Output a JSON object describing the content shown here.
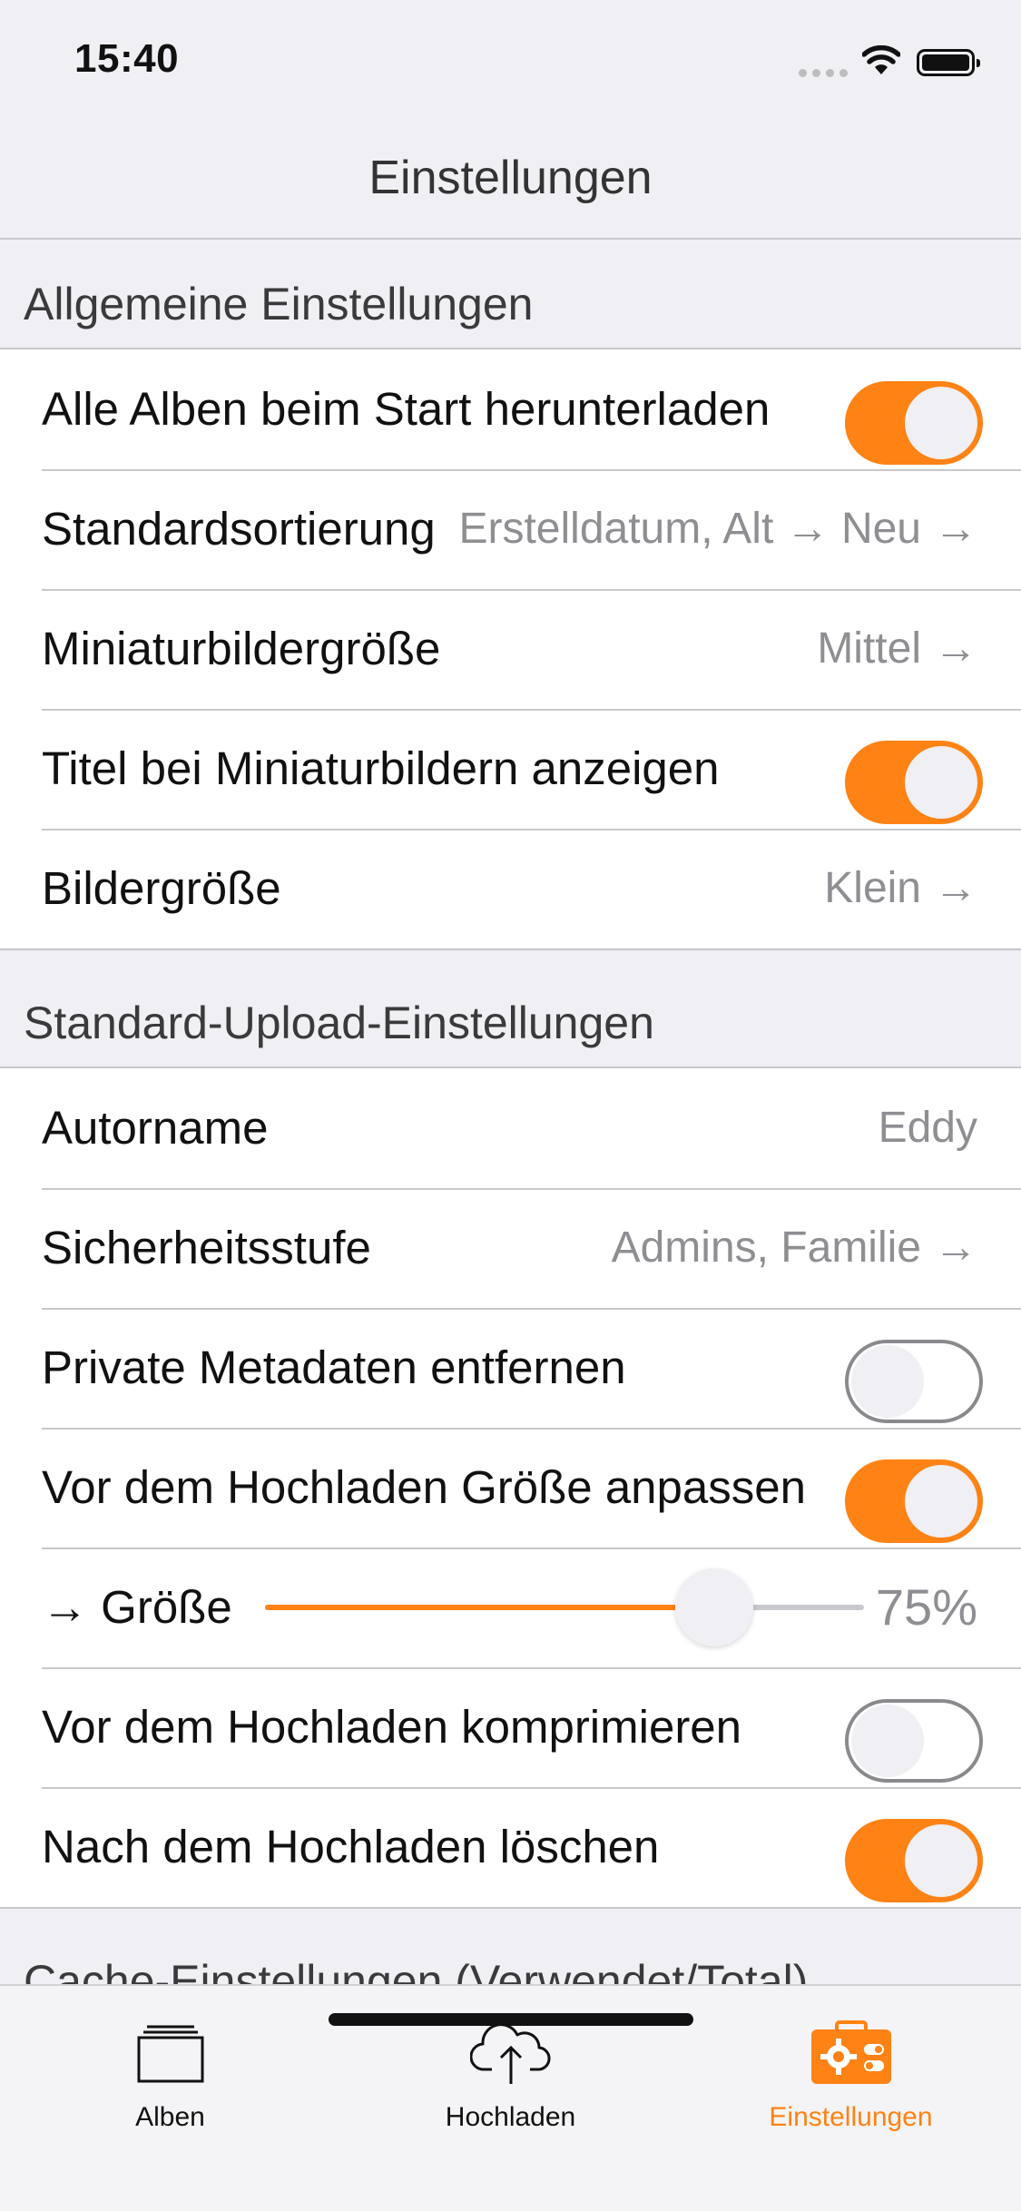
{
  "status_bar": {
    "time": "15:40"
  },
  "navbar": {
    "title": "Einstellungen"
  },
  "colors": {
    "accent": "#ff8214",
    "background": "#efeff4",
    "secondary_text": "#8e8e93"
  },
  "sections": {
    "general": {
      "header": "Allgemeine Einstellungen",
      "download_all_label": "Alle Alben beim Start herunterladen",
      "download_all_on": true,
      "default_sort_label": "Standardsortierung",
      "default_sort_value": "Erstelldatum, Alt → Neu",
      "thumb_size_label": "Miniaturbildergröße",
      "thumb_size_value": "Mittel",
      "show_titles_label": "Titel bei Miniaturbildern anzeigen",
      "show_titles_on": true,
      "image_size_label": "Bildergröße",
      "image_size_value": "Klein"
    },
    "upload": {
      "header": "Standard-Upload-Einstellungen",
      "author_label": "Autorname",
      "author_value": "Eddy",
      "privacy_label": "Sicherheitsstufe",
      "privacy_value": "Admins, Familie",
      "strip_metadata_label": "Private Metadaten entfernen",
      "strip_metadata_on": false,
      "resize_label": "Vor dem Hochladen Größe anpassen",
      "resize_on": true,
      "size_label": "→ Größe",
      "size_value": "75%",
      "size_fraction": 0.75,
      "compress_label": "Vor dem Hochladen komprimieren",
      "compress_on": false,
      "delete_label": "Nach dem Hochladen löschen",
      "delete_on": true
    },
    "cache": {
      "header": "Cache-Einstellungen (Verwendet/Total)"
    }
  },
  "arrow_glyph": "→",
  "tabbar": {
    "items": [
      {
        "label": "Alben",
        "icon": "albums-icon",
        "active": false
      },
      {
        "label": "Hochladen",
        "icon": "cloud-upload-icon",
        "active": false
      },
      {
        "label": "Einstellungen",
        "icon": "settings-toolbox-icon",
        "active": true
      }
    ]
  }
}
